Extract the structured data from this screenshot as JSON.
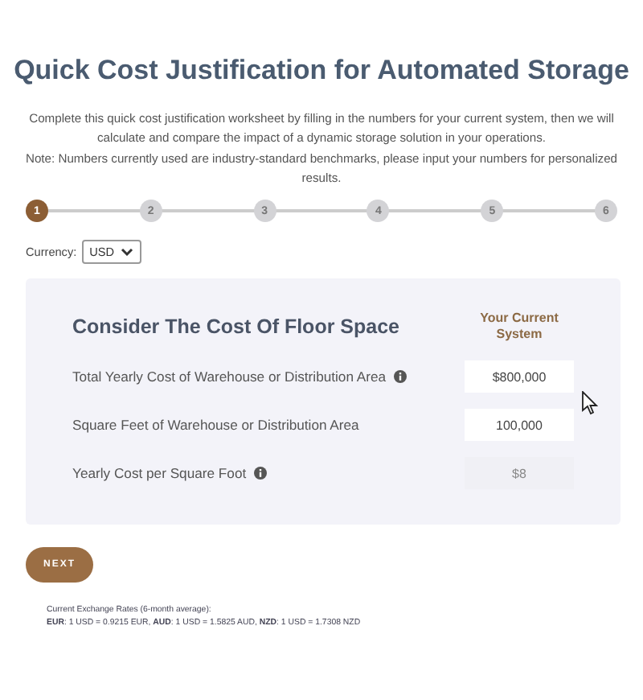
{
  "title": "Quick Cost Justification for Automated Storage",
  "intro": [
    "Complete this quick cost justification worksheet by filling in the numbers for your current system, then we will calculate and compare the impact of a dynamic storage solution in your operations.",
    "Note: Numbers currently used are industry-standard benchmarks, please input your numbers for personalized results."
  ],
  "steps": [
    {
      "label": "1",
      "selected": true
    },
    {
      "label": "2",
      "selected": false
    },
    {
      "label": "3",
      "selected": false
    },
    {
      "label": "4",
      "selected": false
    },
    {
      "label": "5",
      "selected": false
    },
    {
      "label": "6",
      "selected": false
    }
  ],
  "currency": {
    "label": "Currency:",
    "value": "USD"
  },
  "panel": {
    "heading": "Consider The Cost Of Floor Space",
    "column_header": "Your Current System",
    "rows": [
      {
        "label": "Total Yearly Cost of Warehouse or Distribution Area",
        "info": true,
        "value": "$800,000",
        "disabled": false
      },
      {
        "label": "Square Feet of Warehouse or Distribution Area",
        "info": false,
        "value": "100,000",
        "disabled": false
      },
      {
        "label": "Yearly Cost per Square Foot",
        "info": true,
        "value": "$8",
        "disabled": true
      }
    ]
  },
  "next_button": "NEXT",
  "exchange": {
    "title": "Current Exchange Rates (6-month average):",
    "rates": "**EUR**: 1 USD = 0.9215 EUR, **AUD**: 1 USD = 1.5825 AUD, **NZD**: 1 USD = 1.7308 NZD"
  }
}
